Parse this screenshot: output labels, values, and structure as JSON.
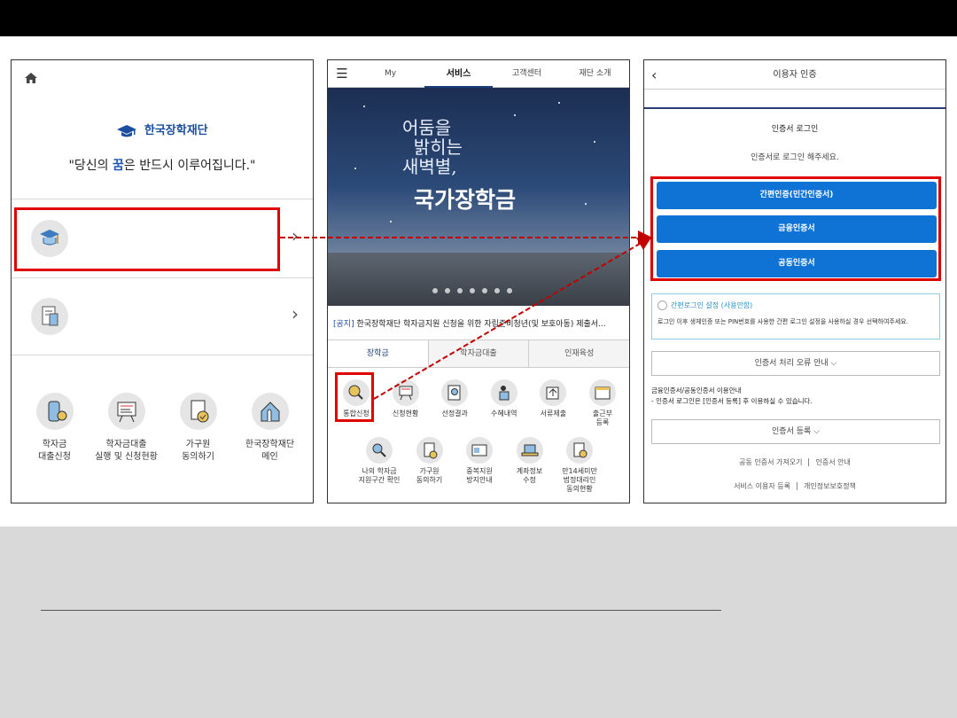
{
  "screen1": {
    "logo_text": "한국장학재단",
    "slogan_pre": "\"당신의 ",
    "slogan_em": "꿈",
    "slogan_post": "은 반드시 이루어집니다.\"",
    "chevron": "›",
    "grid": [
      {
        "icon": "coin-jar-icon",
        "label": "학자금\n대출신청"
      },
      {
        "icon": "easel-chart-icon",
        "label": "학자금대출\n실행 및 신청현황"
      },
      {
        "icon": "document-check-icon",
        "label": "가구원\n동의하기"
      },
      {
        "icon": "hand-house-icon",
        "label": "한국장학재단\n메인"
      }
    ]
  },
  "screen2": {
    "nav_tabs": [
      "My",
      "서비스",
      "고객센터",
      "재단 소개"
    ],
    "active_tab": "서비스",
    "banner_line1": "어둠을\n  밝히는\n새벽별,",
    "banner_line2": "국가장학금",
    "notice_tag": "[공지]",
    "notice_text": " 한국장학재단 학자금지원 신청을 위한 자립준비청년(및 보호아동) 제출서...",
    "sub_tabs": [
      "장학금",
      "학자금대출",
      "인재육성"
    ],
    "row1": [
      {
        "icon": "magnifier-pen-icon",
        "label": "통합신청"
      },
      {
        "icon": "board-icon",
        "label": "신청현황"
      },
      {
        "icon": "search-doc-icon",
        "label": "선정결과"
      },
      {
        "icon": "person-list-icon",
        "label": "수혜내역"
      },
      {
        "icon": "upload-doc-icon",
        "label": "서류제출"
      },
      {
        "icon": "calendar-icon",
        "label": "출근부\n등록"
      }
    ],
    "row2": [
      {
        "icon": "person-search-icon",
        "label": "나의 학자금\n지원구간 확인"
      },
      {
        "icon": "doc-sign-icon",
        "label": "가구원\n동의하기"
      },
      {
        "icon": "window-icon",
        "label": "중복지원\n방지안내"
      },
      {
        "icon": "laptop-icon",
        "label": "계좌정보\n수정"
      },
      {
        "icon": "doc-person-icon",
        "label": "만14세미만\n법정대리인\n동의현황"
      }
    ]
  },
  "screen3": {
    "back": "‹",
    "title": "이용자 인증",
    "section_title": "인증서 로그인",
    "instruction": "인증서로 로그인 해주세요.",
    "buttons": [
      "간편인증(민간인증서)",
      "금융인증서",
      "공동인증서"
    ],
    "easy_login": "간편로그인 설정 (사용안함)",
    "easy_desc": "로그인 이후 생체인증 또는 PIN번호를 사용한 간편 로그인 설정을 사용하실 경우 선택하여주세요.",
    "error_guide": "인증서 처리 오류 안내  ⌵",
    "guide_title": "금융인증서/공동인증서 이용안내",
    "guide_text": "- 인증서 로그인은 [인증서 등록] 후 이용하실 수 있습니다.",
    "register": "인증서 등록  ⌵",
    "foot1a": "공동 인증서 가져오기",
    "foot1b": "인증서 안내",
    "foot2a": "서비스 이용자 등록",
    "foot2b": "개인정보보호정책"
  },
  "colors": {
    "highlight": "#e00000",
    "button_blue": "#0f73d6",
    "navy": "#1f3d7a"
  }
}
